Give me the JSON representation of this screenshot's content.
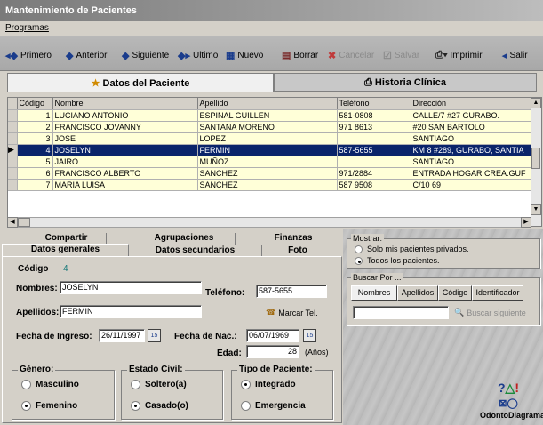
{
  "window": {
    "title": "Mantenimiento de Pacientes"
  },
  "menu": {
    "programas": "Programas"
  },
  "toolbar": {
    "primero": "Primero",
    "anterior": "Anterior",
    "siguiente": "Siguiente",
    "ultimo": "Ultimo",
    "nuevo": "Nuevo",
    "borrar": "Borrar",
    "cancelar": "Cancelar",
    "salvar": "Salvar",
    "imprimir": "Imprimir",
    "salir": "Salir"
  },
  "tabs": {
    "datos_paciente": "Datos del Paciente",
    "historia": "Historia Clínica"
  },
  "grid": {
    "columns": [
      "Código",
      "Nombre",
      "Apellido",
      "Teléfono",
      "Dirección"
    ],
    "rows": [
      [
        "1",
        "LUCIANO ANTONIO",
        "ESPINAL GUILLEN",
        "581-0808",
        "CALLE/7 #27 GURABO."
      ],
      [
        "2",
        "FRANCISCO JOVANNY",
        "SANTANA MORENO",
        "971 8613",
        "#20 SAN BARTOLO"
      ],
      [
        "3",
        "JOSE",
        "LOPEZ",
        "",
        "SANTIAGO"
      ],
      [
        "4",
        "JOSELYN",
        "FERMIN",
        "587-5655",
        "KM 8 #289, GURABO, SANTIA"
      ],
      [
        "5",
        "JAIRO",
        "MUÑOZ",
        "",
        "SANTIAGO"
      ],
      [
        "6",
        "FRANCISCO ALBERTO",
        "SANCHEZ",
        "971/2884",
        "ENTRADA HOGAR CREA.GUF"
      ],
      [
        "7",
        "MARIA LUISA",
        "SANCHEZ",
        "587 9508",
        "C/10 69"
      ]
    ],
    "selected_row": 3
  },
  "subtabs": {
    "compartir": "Compartir",
    "agrupaciones": "Agrupaciones",
    "finanzas": "Finanzas",
    "datos_generales": "Datos generales",
    "datos_secundarios": "Datos secundarios",
    "foto": "Foto"
  },
  "form": {
    "codigo_label": "Código",
    "codigo_value": "4",
    "nombres_label": "Nombres:",
    "nombres_value": "JOSELYN",
    "telefono_label": "Teléfono:",
    "telefono_value": "587-5655",
    "apellidos_label": "Apellidos:",
    "apellidos_value": "FERMIN",
    "marcar_tel": "Marcar Tel.",
    "fecha_ingreso_label": "Fecha de Ingreso:",
    "fecha_ingreso_value": "26/11/1997",
    "fecha_nac_label": "Fecha de Nac.:",
    "fecha_nac_value": "06/07/1969",
    "cal_icon": "15",
    "edad_label": "Edad:",
    "edad_value": "28",
    "edad_unit": "(Años)",
    "genero_title": "Género:",
    "masculino": "Masculino",
    "femenino": "Femenino",
    "estado_title": "Estado Civil:",
    "soltero": "Soltero(a)",
    "casado": "Casado(o)",
    "tipo_title": "Tipo de Paciente:",
    "integrado": "Integrado",
    "emergencia": "Emergencia"
  },
  "mostrar": {
    "title": "Mostrar:",
    "privados": "Solo mis pacientes privados.",
    "todos": "Todos los pacientes."
  },
  "buscar": {
    "title": "Buscar Por ...",
    "tabs": [
      "Nombres",
      "Apellidos",
      "Código",
      "Identificador"
    ],
    "siguiente": "Buscar siguiente"
  },
  "odontodiagrama": "OdontoDiagrama"
}
